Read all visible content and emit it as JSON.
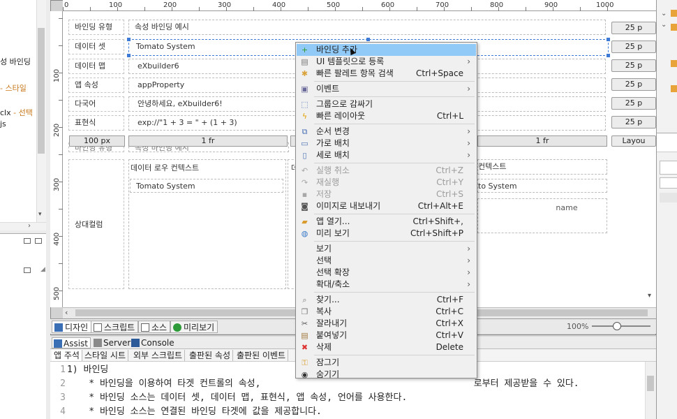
{
  "left_panel": {
    "items": [
      {
        "text": "성 바인딩",
        "color": "#222"
      },
      {
        "text": "- 스타일",
        "color": "#c8771a"
      },
      {
        "text": "clx - 선택",
        "color": "#222"
      },
      {
        "text": "js",
        "color": "#222"
      }
    ]
  },
  "ruler": {
    "top": [
      "0",
      "100",
      "200",
      "300",
      "400",
      "500",
      "600",
      "700",
      "800",
      "900",
      "1000"
    ],
    "left": [
      "100",
      "200",
      "300",
      "400",
      "500"
    ]
  },
  "canvas": {
    "rows": [
      {
        "label": "바인딩 유형",
        "value": "속성 바인딩 예시"
      },
      {
        "label": "데이터 셋",
        "value": "Tomato System"
      },
      {
        "label": "데이터 맵",
        "value": "eXbuilder6"
      },
      {
        "label": "앱 속성",
        "value": "appProperty"
      },
      {
        "label": "다국어",
        "value": "안녕하세요, eXbuilder6!"
      },
      {
        "label": "표현식",
        "value": "exp://\"1 + 3 = \" + (1 + 3)"
      }
    ],
    "row_sizes": [
      "25 p",
      "25 p",
      "25 p",
      "25 p",
      "25 p",
      "25 p"
    ],
    "col_sizes": {
      "first": "100 px",
      "second": "1 fr",
      "fourth": "1 fr",
      "layout": "Layou"
    },
    "bottom": {
      "hidden_label": "바인딩 유형",
      "hidden_value": "속성 바인딩 예시",
      "side_label": "상대컬럼",
      "row_context_title": "데이터 로우 컨텍스트",
      "row_context_value": "Tomato System",
      "left_cut": "데",
      "right_context_title": "컨텍스트",
      "right_context_value": "to System",
      "grid_header": "name"
    }
  },
  "editor_tabs": [
    {
      "label": "디자인",
      "icon": "design-icon"
    },
    {
      "label": "스크립트",
      "icon": "script-icon"
    },
    {
      "label": "소스",
      "icon": "source-icon"
    },
    {
      "label": "미리보기",
      "icon": "preview-icon"
    }
  ],
  "zoom": "100%",
  "assist": {
    "tabs": [
      {
        "label": "Assist",
        "icon": "assist-icon"
      },
      {
        "label": "Servers",
        "icon": "servers-icon"
      },
      {
        "label": "Console",
        "icon": "console-icon"
      }
    ],
    "subtabs": [
      "앱 주석",
      "스타일 시트",
      "외부 스크립트",
      "출판된 속성",
      "출판된 이벤트"
    ],
    "code": [
      {
        "n": "1",
        "text": "1) 바인딩"
      },
      {
        "n": "2",
        "text": "    * 바인딩을 이용하여 타겟 컨트롤의 속성,                                       로부터 제공받을 수 있다."
      },
      {
        "n": "3",
        "text": "    * 바인딩 소스는 데이터 셋, 데이터 맵, 표현식, 앱 속성, 언어를 사용한다."
      },
      {
        "n": "4",
        "text": "    * 바인딩 소스는 연결된 바인딩 타겟에 값을 제공합니다."
      }
    ]
  },
  "context_menu": [
    {
      "label": "바인딩 추가",
      "shortcut": "",
      "arrow": false,
      "icon": "add-icon",
      "glyph": "+",
      "color": "#2f9a2f",
      "highlight": true
    },
    {
      "label": "UI 템플릿으로 등록",
      "shortcut": "",
      "arrow": true,
      "icon": "template-icon",
      "glyph": "▤",
      "color": "#7a7a7a"
    },
    {
      "label": "빠른 팔레트 항목 검색",
      "shortcut": "Ctrl+Space",
      "arrow": false,
      "icon": "palette-icon",
      "glyph": "✱",
      "color": "#d9a23a"
    },
    {
      "sep": true
    },
    {
      "label": "이벤트",
      "shortcut": "",
      "arrow": true,
      "icon": "event-icon",
      "glyph": "▣",
      "color": "#6a6a9a"
    },
    {
      "sep": true
    },
    {
      "label": "그룹으로 감싸기",
      "shortcut": "",
      "arrow": false,
      "icon": "group-icon",
      "glyph": "⬚",
      "color": "#5a7ab5"
    },
    {
      "label": "빠른 레이아웃",
      "shortcut": "Ctrl+L",
      "arrow": false,
      "icon": "lightning-icon",
      "glyph": "ϟ",
      "color": "#e1a200"
    },
    {
      "sep": true
    },
    {
      "label": "순서 변경",
      "shortcut": "",
      "arrow": true,
      "icon": "order-icon",
      "glyph": "⧉",
      "color": "#4a6fb5"
    },
    {
      "label": "가로 배치",
      "shortcut": "",
      "arrow": true,
      "icon": "horizontal-icon",
      "glyph": "▭",
      "color": "#4a6fb5"
    },
    {
      "label": "세로 배치",
      "shortcut": "",
      "arrow": true,
      "icon": "vertical-icon",
      "glyph": "▯",
      "color": "#4a6fb5"
    },
    {
      "sep": true
    },
    {
      "label": "실행 취소",
      "shortcut": "Ctrl+Z",
      "arrow": false,
      "icon": "undo-icon",
      "glyph": "↶",
      "color": "#a8a8a8",
      "disabled": true
    },
    {
      "label": "재실행",
      "shortcut": "Ctrl+Y",
      "arrow": false,
      "icon": "redo-icon",
      "glyph": "↷",
      "color": "#a8a8a8",
      "disabled": true
    },
    {
      "label": "저장",
      "shortcut": "Ctrl+S",
      "arrow": false,
      "icon": "save-icon",
      "glyph": "▪",
      "color": "#a8a8a8",
      "disabled": true
    },
    {
      "label": "이미지로 내보내기",
      "shortcut": "Ctrl+Alt+E",
      "arrow": false,
      "icon": "camera-icon",
      "glyph": "◙",
      "color": "#555"
    },
    {
      "sep": true
    },
    {
      "label": "앱 열기...",
      "shortcut": "Ctrl+Shift+,",
      "arrow": false,
      "icon": "open-folder-icon",
      "glyph": "▰",
      "color": "#d99b2b"
    },
    {
      "label": "미리 보기",
      "shortcut": "Ctrl+Shift+P",
      "arrow": false,
      "icon": "preview-globe-icon",
      "glyph": "◍",
      "color": "#3a7ac8"
    },
    {
      "sep": true
    },
    {
      "label": "보기",
      "shortcut": "",
      "arrow": true,
      "icon": "",
      "glyph": "",
      "color": "#555"
    },
    {
      "label": "선택",
      "shortcut": "",
      "arrow": true,
      "icon": "",
      "glyph": "",
      "color": "#555"
    },
    {
      "label": "선택 확장",
      "shortcut": "",
      "arrow": true,
      "icon": "",
      "glyph": "",
      "color": "#555"
    },
    {
      "label": "확대/축소",
      "shortcut": "",
      "arrow": true,
      "icon": "",
      "glyph": "",
      "color": "#555"
    },
    {
      "sep": true
    },
    {
      "label": "찾기...",
      "shortcut": "Ctrl+F",
      "arrow": false,
      "icon": "find-icon",
      "glyph": "⌕",
      "color": "#777"
    },
    {
      "label": "복사",
      "shortcut": "Ctrl+C",
      "arrow": false,
      "icon": "copy-icon",
      "glyph": "❐",
      "color": "#777"
    },
    {
      "label": "잘라내기",
      "shortcut": "Ctrl+X",
      "arrow": false,
      "icon": "cut-icon",
      "glyph": "✂",
      "color": "#555"
    },
    {
      "label": "붙여넣기",
      "shortcut": "Ctrl+V",
      "arrow": false,
      "icon": "paste-icon",
      "glyph": "▤",
      "color": "#a07a40"
    },
    {
      "label": "삭제",
      "shortcut": "Delete",
      "arrow": false,
      "icon": "delete-icon",
      "glyph": "✖",
      "color": "#d33"
    },
    {
      "sep": true
    },
    {
      "label": "잠그기",
      "shortcut": "",
      "arrow": false,
      "icon": "lock-icon",
      "glyph": "⚿",
      "color": "#d9a23a"
    },
    {
      "label": "숨기기",
      "shortcut": "",
      "arrow": false,
      "icon": "hide-icon",
      "glyph": "◉",
      "color": "#333"
    }
  ]
}
